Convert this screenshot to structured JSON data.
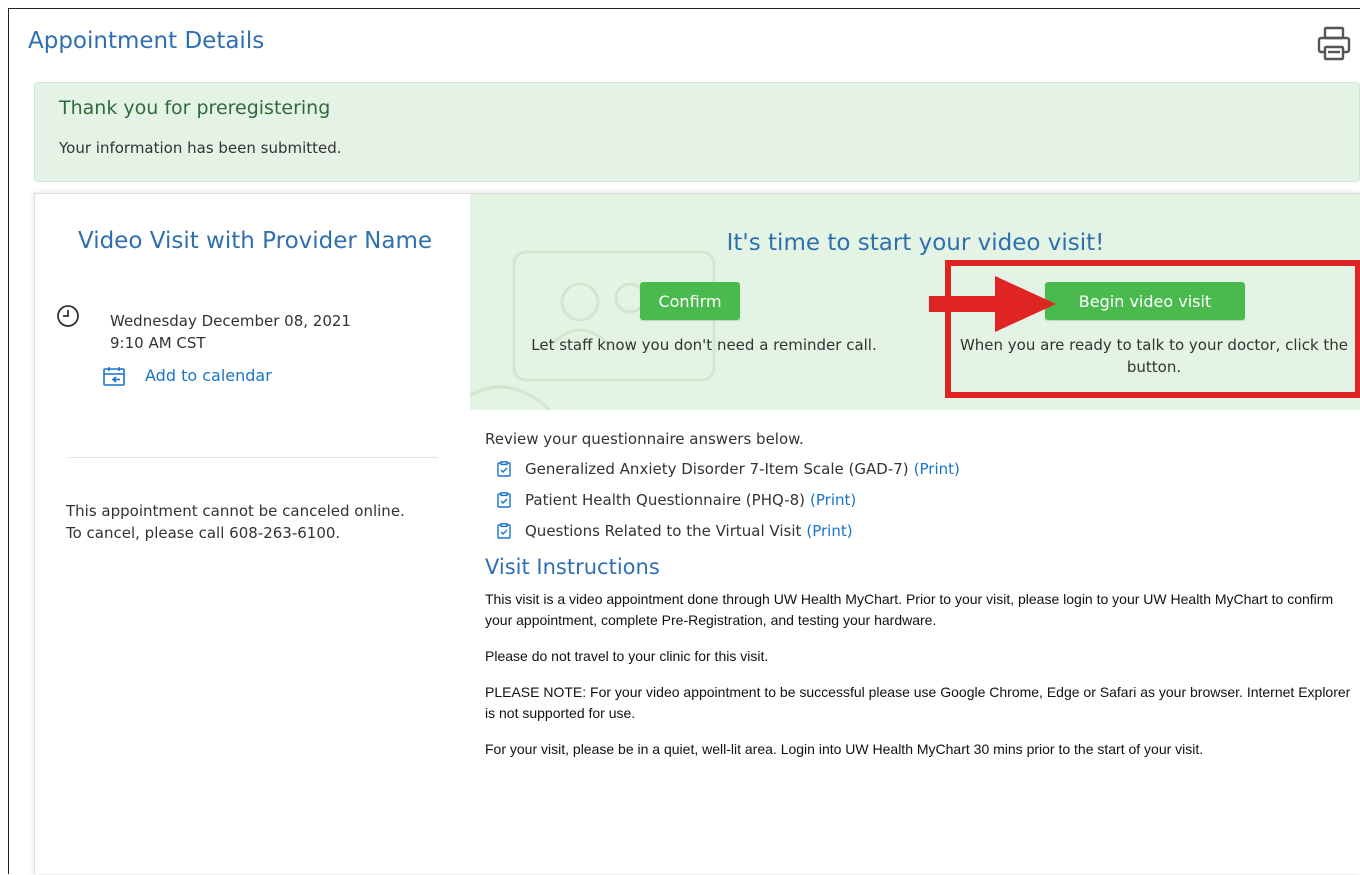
{
  "page": {
    "title": "Appointment Details",
    "print_icon": "printer-icon"
  },
  "banner": {
    "title": "Thank you for preregistering",
    "subtitle": "Your information has been submitted."
  },
  "appointment": {
    "title": "Video Visit with Provider Name",
    "date": "Wednesday December 08, 2021",
    "time": "9:10 AM CST",
    "add_to_calendar": "Add to calendar",
    "cancel_note": "This appointment cannot be canceled online. To cancel, please call 608-263-6100."
  },
  "actions": {
    "heading": "It's time to start your video visit!",
    "confirm_label": "Confirm",
    "confirm_note": "Let staff know you don't need a reminder call.",
    "begin_label": "Begin video visit",
    "begin_note": "When you are ready to talk to your doctor, click the button."
  },
  "questionnaires": {
    "intro": "Review your questionnaire answers below.",
    "print_label": "(Print)",
    "items": [
      "Generalized Anxiety Disorder 7-Item Scale (GAD-7)",
      "Patient Health Questionnaire (PHQ-8)",
      "Questions Related to the Virtual Visit"
    ]
  },
  "instructions": {
    "title": "Visit Instructions",
    "paragraphs": [
      "This visit is a video appointment done through UW Health MyChart. Prior to your visit, please login to your UW Health MyChart to confirm your appointment, complete Pre-Registration, and testing your hardware.",
      "Please do not travel to your clinic for this visit.",
      "PLEASE NOTE:  For your video appointment to be successful please use Google Chrome, Edge or Safari as your browser.  Internet Explorer is not supported for use.",
      "For your visit, please be in a quiet, well-lit area.  Login into UW Health MyChart 30 mins prior to the start of your visit."
    ]
  },
  "colors": {
    "accent_blue": "#2f6fb0",
    "link_blue": "#1a73c8",
    "button_green": "#4ab94e",
    "panel_green": "#e4f4e4",
    "highlight_red": "#e02424"
  }
}
